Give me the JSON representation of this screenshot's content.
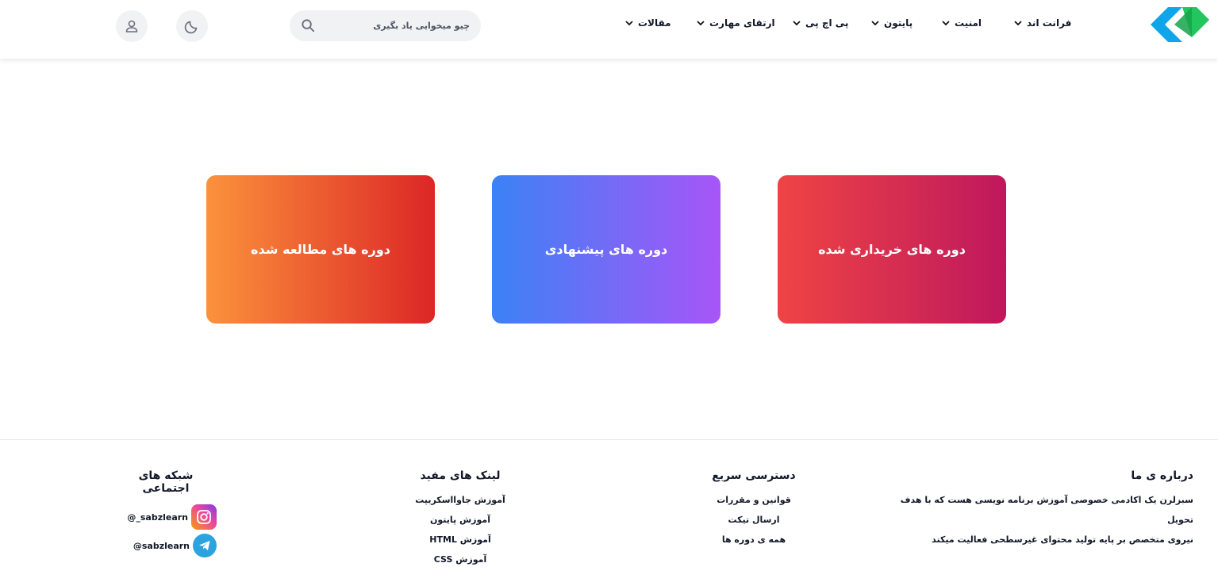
{
  "header": {
    "nav": [
      {
        "label": "فرانت اند"
      },
      {
        "label": "امنیت"
      },
      {
        "label": "پایتون"
      },
      {
        "label": "پی اچ پی"
      },
      {
        "label": "ارتقای مهارت"
      },
      {
        "label": "مقالات"
      }
    ],
    "search_placeholder": "چیو میخوایی یاد بگیری"
  },
  "cards": {
    "purchased": "دوره های خریداری شده",
    "suggested": "دوره های پیشنهادی",
    "studied": "دوره های مطالعه شده"
  },
  "footer": {
    "about": {
      "title": "درباره ی ما",
      "line1": "سبزلرن یک اکادمی خصوصی آموزش برنامه نویسی هست که با هدف تحویل",
      "line2": "نیروی متخصص بر پایه تولید محتوای غیرسطحی فعالیت میکند"
    },
    "quick": {
      "title": "دسترسی سریع",
      "links": [
        "قوانین و مقررات",
        "ارسال تیکت",
        "همه ی دوره ها"
      ]
    },
    "useful": {
      "title": "لینک های مفید",
      "links": [
        "آموزش جاوااسکریپت",
        "آموزش پایتون",
        "آموزش HTML",
        "آموزش CSS"
      ]
    },
    "social": {
      "title": "شبکه های اجتماعی",
      "instagram": "sabzlearn_@",
      "telegram": "sabzlearn@"
    }
  },
  "colors": {
    "logo_blue": "#0ea5e9",
    "logo_green": "#22c55e"
  }
}
